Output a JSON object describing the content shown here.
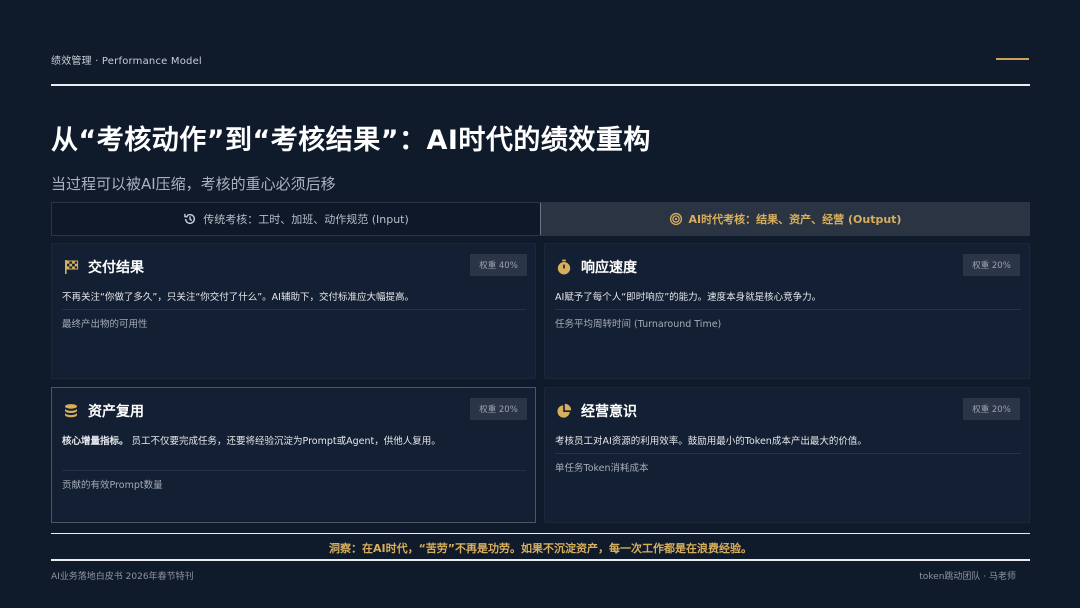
{
  "header": {
    "label": "绩效管理 · Performance Model",
    "accent_color": "#c8a15a"
  },
  "title": "从“考核动作”到“考核结果”：AI时代的绩效重构",
  "subtitle": "当过程可以被AI压缩，考核的重心必须后移",
  "tabs": [
    {
      "label": "传统考核：工时、加班、动作规范 (Input)",
      "icon": "history-icon",
      "active": false
    },
    {
      "label": "AI时代考核：结果、资产、经营 (Output)",
      "icon": "target-icon",
      "active": true
    }
  ],
  "cards": [
    {
      "title": "交付结果",
      "icon": "checkered-flag-icon",
      "weight": "权重 40%",
      "desc": "不再关注“你做了多久”，只关注“你交付了什么”。AI辅助下，交付标准应大幅提高。",
      "desc_bold": "",
      "metric": "最终产出物的可用性"
    },
    {
      "title": "响应速度",
      "icon": "stopwatch-icon",
      "weight": "权重 20%",
      "desc": "AI赋予了每个人“即时响应”的能力。速度本身就是核心竞争力。",
      "desc_bold": "",
      "metric": "任务平均周转时间 (Turnaround Time)"
    },
    {
      "title": "资产复用",
      "icon": "coins-icon",
      "weight": "权重 20%",
      "desc_bold": "核心增量指标。",
      "desc": "员工不仅要完成任务，还要将经验沉淀为Prompt或Agent，供他人复用。",
      "metric": "贡献的有效Prompt数量"
    },
    {
      "title": "经营意识",
      "icon": "pie-chart-icon",
      "weight": "权重 20%",
      "desc": "考核员工对AI资源的利用效率。鼓励用最小的Token成本产出最大的价值。",
      "desc_bold": "",
      "metric": "单任务Token消耗成本"
    }
  ],
  "insight": "洞察：在AI时代，“苦劳”不再是功劳。如果不沉淀资产，每一次工作都是在浪费经验。",
  "footer": {
    "left": "AI业务落地白皮书 2026年春节特刊",
    "right": "token跳动团队 · 马老师"
  },
  "colors": {
    "background": "#0f1a2b",
    "card": "#131f32",
    "accent": "#d6ae5c"
  }
}
